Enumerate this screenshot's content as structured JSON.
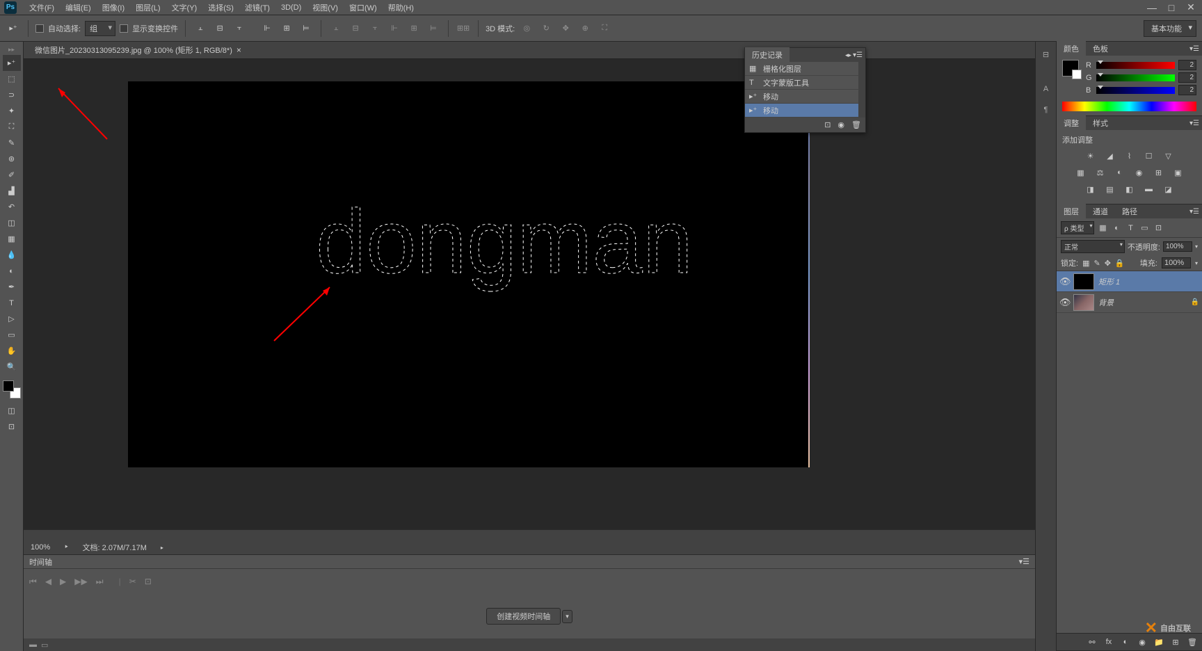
{
  "menu": {
    "items": [
      "文件(F)",
      "编辑(E)",
      "图像(I)",
      "图层(L)",
      "文字(Y)",
      "选择(S)",
      "滤镜(T)",
      "3D(D)",
      "视图(V)",
      "窗口(W)",
      "帮助(H)"
    ]
  },
  "options": {
    "auto_select": "自动选择:",
    "group": "组",
    "show_transform": "显示变换控件",
    "mode_3d": "3D 模式:",
    "workspace": "基本功能"
  },
  "document": {
    "tab": "微信图片_20230313095239.jpg @ 100% (矩形 1, RGB/8*)",
    "selection_text": "dongman"
  },
  "status": {
    "zoom": "100%",
    "docsize": "文档: 2.07M/7.17M"
  },
  "timeline": {
    "title": "时间轴",
    "create_btn": "创建视频时间轴"
  },
  "history": {
    "title": "历史记录",
    "items": [
      {
        "icon": "▦",
        "label": "栅格化图层"
      },
      {
        "icon": "T",
        "label": "文字蒙版工具"
      },
      {
        "icon": "▸⁺",
        "label": "移动"
      },
      {
        "icon": "▸⁺",
        "label": "移动"
      }
    ]
  },
  "color_panel": {
    "tab1": "颜色",
    "tab2": "色板",
    "r": "R",
    "g": "G",
    "b": "B",
    "r_val": "2",
    "g_val": "2",
    "b_val": "2"
  },
  "adjustments": {
    "tab1": "调整",
    "tab2": "样式",
    "label": "添加调整"
  },
  "layers": {
    "tab1": "图层",
    "tab2": "通道",
    "tab3": "路径",
    "filter": "ρ 类型",
    "blend": "正常",
    "opacity_label": "不透明度:",
    "opacity": "100%",
    "lock_label": "锁定:",
    "fill_label": "填充:",
    "fill": "100%",
    "items": [
      {
        "name": "矩形 1",
        "selected": true,
        "locked": false
      },
      {
        "name": "背景",
        "selected": false,
        "locked": true
      }
    ]
  },
  "watermark": "自由互联"
}
